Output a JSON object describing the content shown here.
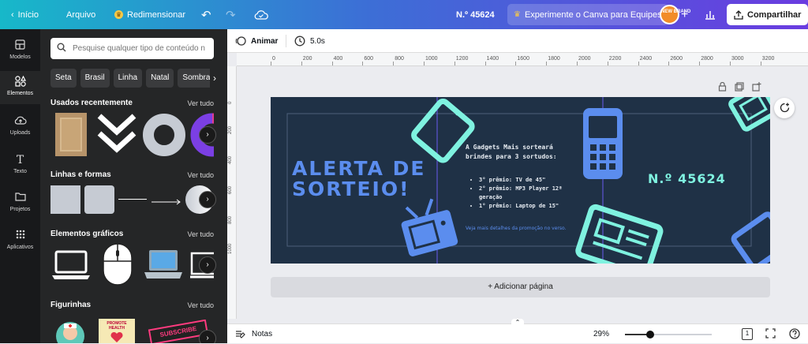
{
  "topbar": {
    "home": "Início",
    "file": "Arquivo",
    "resize": "Redimensionar",
    "doc_number": "N.º 45624",
    "try_canva": "Experimente o Canva para Equipes",
    "avatar_text": "NEW BRAND",
    "share": "Compartilhar"
  },
  "rail": {
    "items": [
      {
        "label": "Modelos",
        "icon": "layout-icon"
      },
      {
        "label": "Elementos",
        "icon": "shapes-icon"
      },
      {
        "label": "Uploads",
        "icon": "cloud-upload-icon"
      },
      {
        "label": "Texto",
        "icon": "text-icon"
      },
      {
        "label": "Projetos",
        "icon": "folder-icon"
      },
      {
        "label": "Aplicativos",
        "icon": "apps-grid-icon"
      }
    ]
  },
  "panel": {
    "search_placeholder": "Pesquise qualquer tipo de conteúdo n",
    "chips": [
      "Seta",
      "Brasil",
      "Linha",
      "Natal",
      "Sombra"
    ],
    "sections": {
      "recent": "Usados recentemente",
      "lines": "Linhas e formas",
      "graphics": "Elementos gráficos",
      "stickers": "Figurinhas"
    },
    "see_all": "Ver tudo",
    "sticker_promote": "PROMOTE HEALTH",
    "sticker_label": "SUBSCRIBE"
  },
  "toolbar": {
    "animate": "Animar",
    "duration": "5.0s"
  },
  "ruler": {
    "h_ticks": [
      "0",
      "200",
      "400",
      "600",
      "800",
      "1000",
      "1200",
      "1400",
      "1600",
      "1800",
      "2000",
      "2200",
      "2400",
      "2600",
      "2800",
      "3000",
      "3200"
    ],
    "v_ticks": [
      "0",
      "200",
      "400",
      "600",
      "800",
      "1000"
    ]
  },
  "design": {
    "headline_line1": "ALERTA DE",
    "headline_line2": "SORTEIO!",
    "intro": "A Gadgets Mais sorteará brindes para 3 sortudos:",
    "prizes": [
      "3° prêmio: TV de 45\"",
      "2° prêmio: MP3 Player 12ª geração",
      "1° prêmio: Laptop de 15\""
    ],
    "footnote": "Veja mais detalhes da promoção no verso.",
    "number": "N.º 45624",
    "colors": {
      "background": "#1f3146",
      "accent_blue": "#5b8dee",
      "accent_mint": "#7ff2e0",
      "text_light": "#e8edf3"
    }
  },
  "add_page": "+ Adicionar página",
  "bottombar": {
    "notes": "Notas",
    "zoom": "29%",
    "page_count": "1",
    "zoom_level": 0.29
  }
}
